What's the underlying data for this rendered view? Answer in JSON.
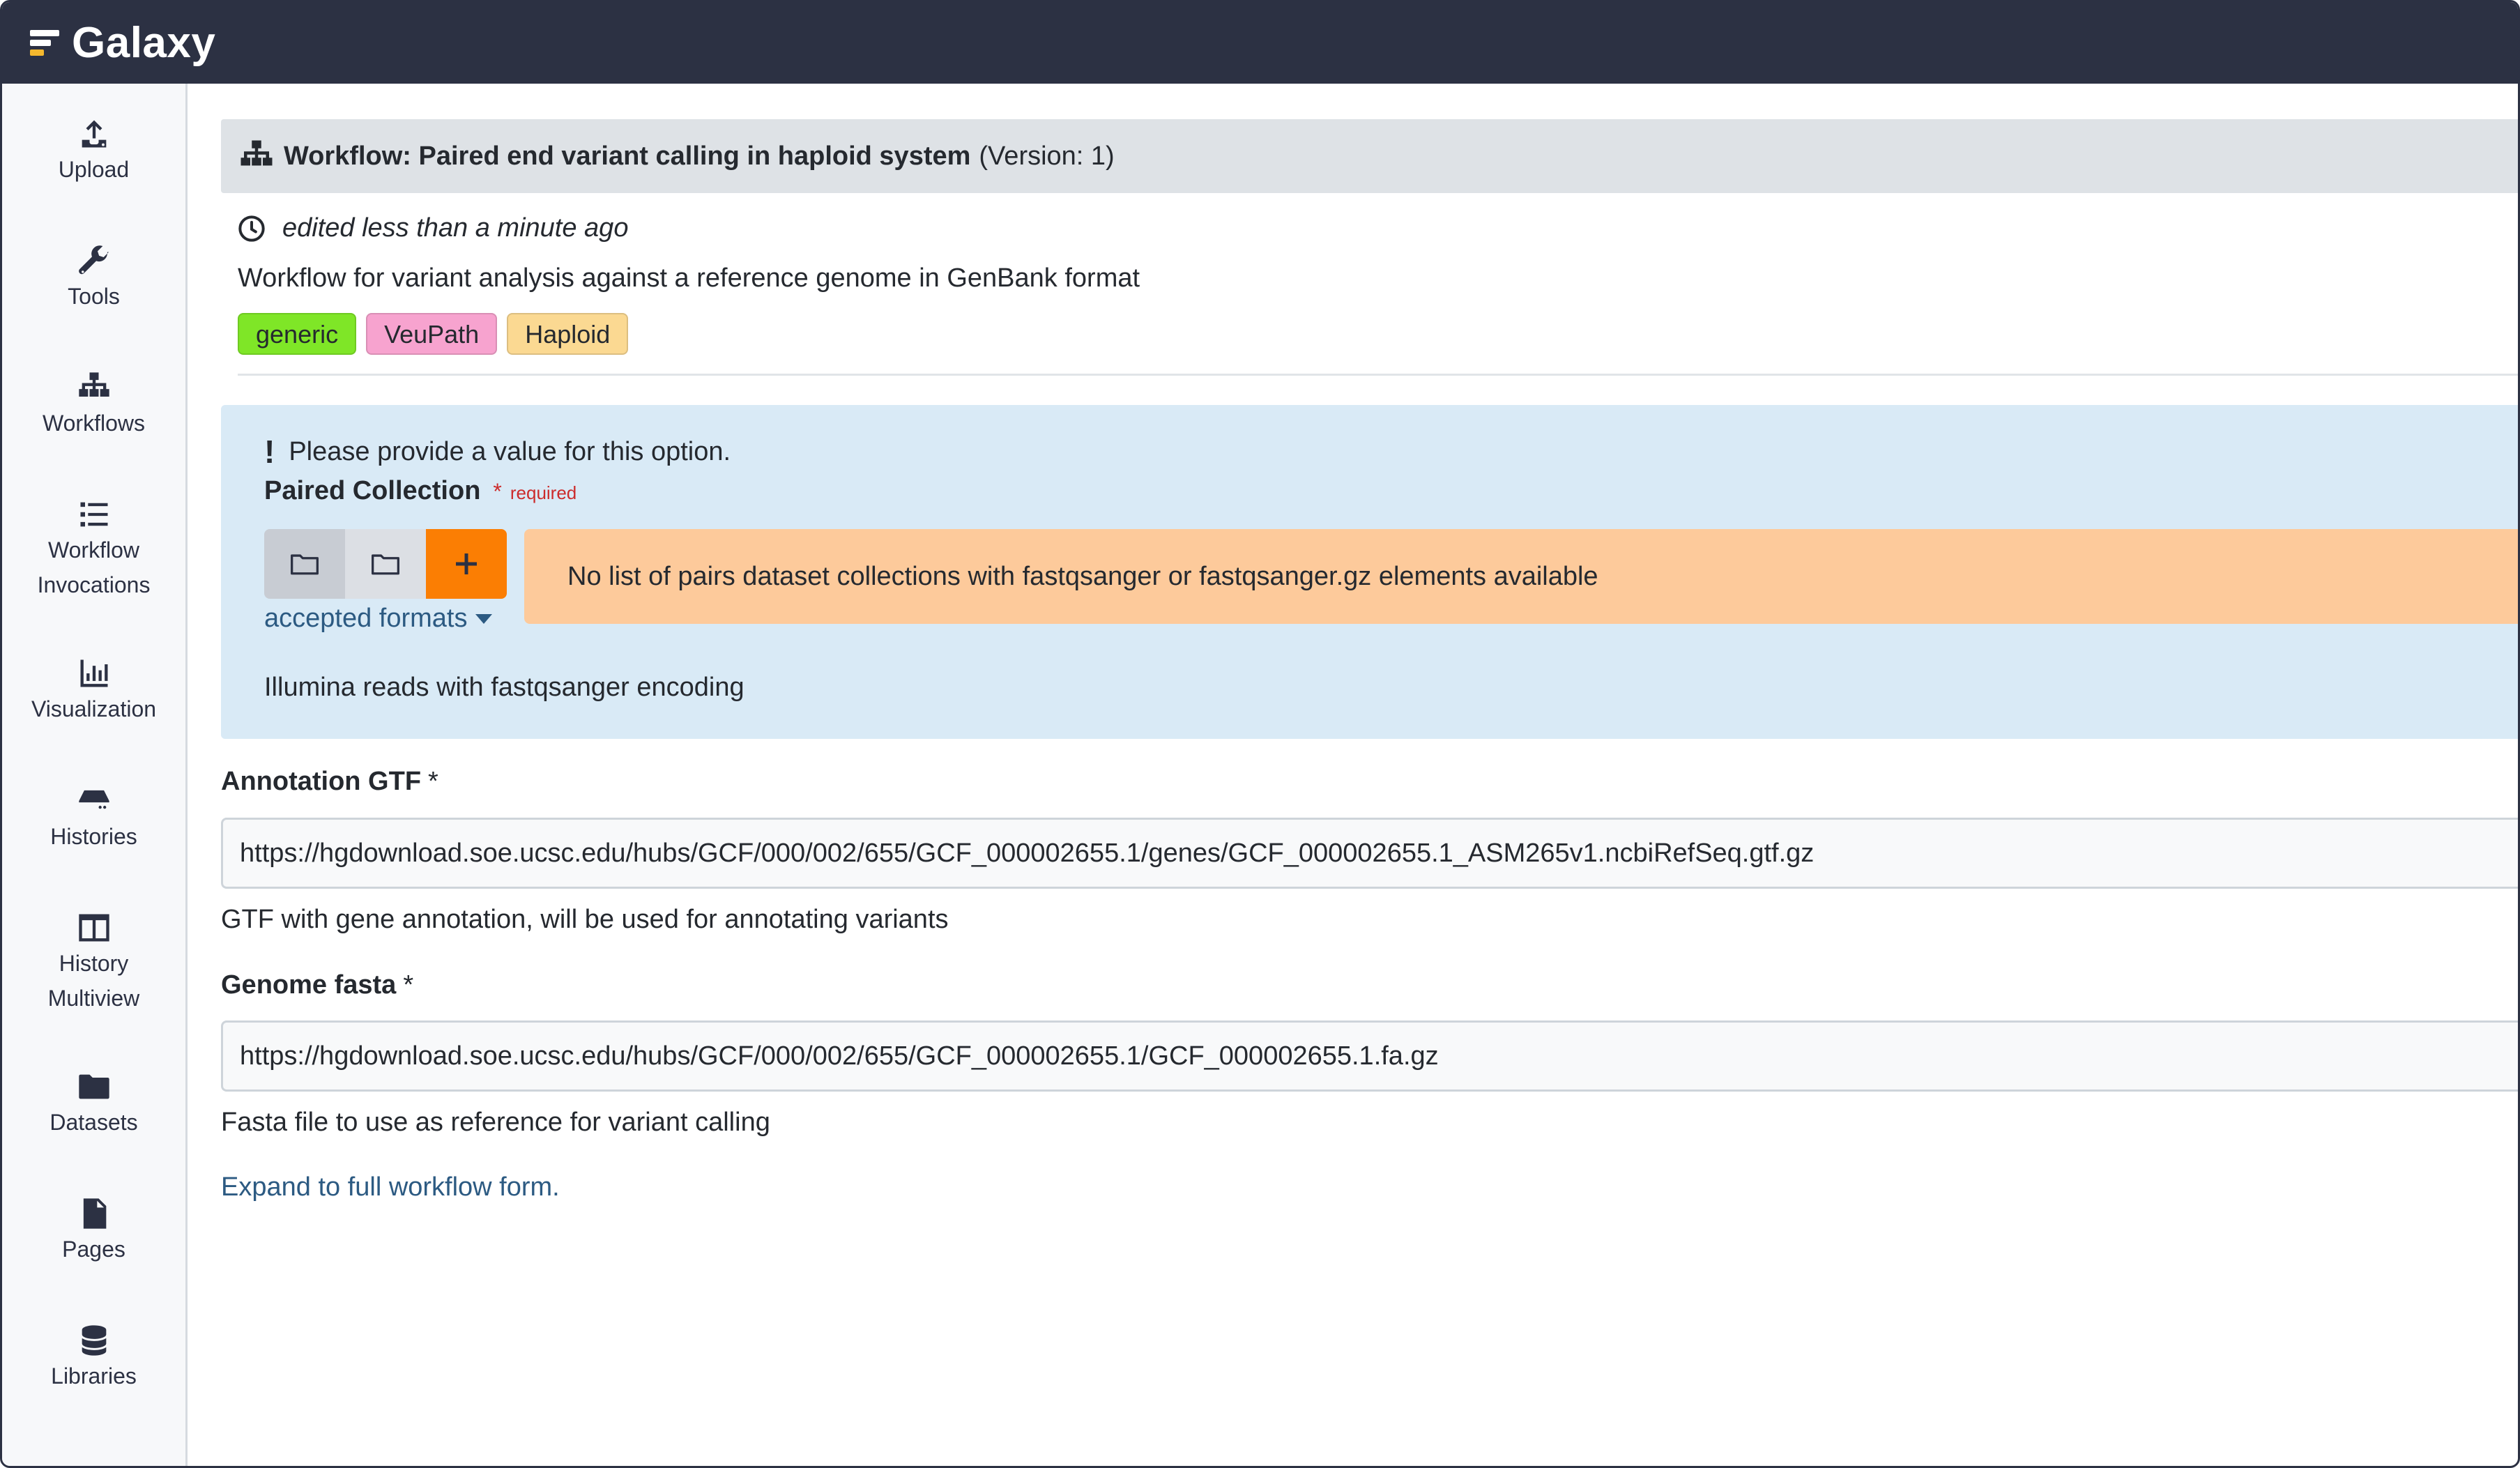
{
  "brand": {
    "name": "Galaxy"
  },
  "activity_bar": {
    "items": [
      {
        "label": "Upload",
        "icon": "upload-icon"
      },
      {
        "label": "Tools",
        "icon": "wrench-icon"
      },
      {
        "label": "Workflows",
        "icon": "sitemap-icon"
      },
      {
        "label": "Workflow Invocations",
        "icon": "list-icon"
      },
      {
        "label": "Visualization",
        "icon": "chart-icon"
      },
      {
        "label": "Histories",
        "icon": "hdd-icon"
      },
      {
        "label": "History Multiview",
        "icon": "columns-icon"
      },
      {
        "label": "Datasets",
        "icon": "folder-icon"
      },
      {
        "label": "Pages",
        "icon": "file-chart-icon"
      },
      {
        "label": "Libraries",
        "icon": "database-icon"
      }
    ]
  },
  "workflow": {
    "title": "Workflow: Paired end variant calling in haploid system",
    "version": "(Version: 1)",
    "edited": "edited less than a minute ago",
    "annotation": "Workflow for variant analysis against a reference genome in GenBank format",
    "tags": [
      {
        "label": "generic",
        "color": "#7fe627"
      },
      {
        "label": "VeuPath",
        "color": "#f7a3cf"
      },
      {
        "label": "Haploid",
        "color": "#fbd992"
      }
    ]
  },
  "paired_collection": {
    "warning": "Please provide a value for this option.",
    "label": "Paired Collection",
    "required_star": "*",
    "required_text": "required",
    "accepted_formats": "accepted formats",
    "no_list_message": "No list of pairs dataset collections with fastqsanger or fastqsanger.gz elements available",
    "help": "Illumina reads with fastqsanger encoding"
  },
  "annotation_gtf": {
    "label": "Annotation GTF",
    "star": "*",
    "value": "https://hgdownload.soe.ucsc.edu/hubs/GCF/000/002/655/GCF_000002655.1/genes/GCF_000002655.1_ASM265v1.ncbiRefSeq.gtf.gz",
    "help": "GTF with gene annotation, will be used for annotating variants"
  },
  "genome_fasta": {
    "label": "Genome fasta",
    "star": "*",
    "value": "https://hgdownload.soe.ucsc.edu/hubs/GCF/000/002/655/GCF_000002655.1/GCF_000002655.1.fa.gz",
    "help": "Fasta file to use as reference for variant calling"
  },
  "expand_link": "Expand to full workflow form."
}
